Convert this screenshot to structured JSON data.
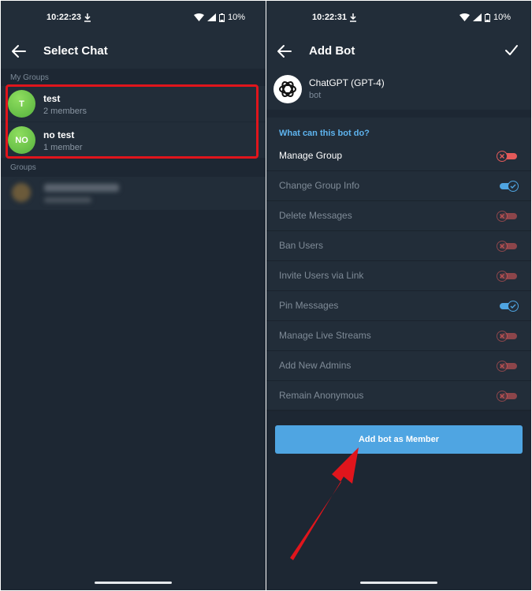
{
  "left": {
    "status_time": "10:22:23",
    "battery": "10%",
    "title": "Select Chat",
    "my_groups_label": "My Groups",
    "groups_label": "Groups",
    "chats": [
      {
        "initials": "T",
        "name": "test",
        "members": "2 members"
      },
      {
        "initials": "NO",
        "name": "no test",
        "members": "1 member"
      }
    ]
  },
  "right": {
    "status_time": "10:22:31",
    "battery": "10%",
    "title": "Add Bot",
    "bot_name": "ChatGPT (GPT-4)",
    "bot_sub": "bot",
    "heading": "What can this bot do?",
    "permissions": [
      {
        "label": "Manage Group",
        "enabled": false,
        "active": true
      },
      {
        "label": "Change Group Info",
        "enabled": true,
        "active": false
      },
      {
        "label": "Delete Messages",
        "enabled": false,
        "active": false
      },
      {
        "label": "Ban Users",
        "enabled": false,
        "active": false
      },
      {
        "label": "Invite Users via Link",
        "enabled": false,
        "active": false
      },
      {
        "label": "Pin Messages",
        "enabled": true,
        "active": false
      },
      {
        "label": "Manage Live Streams",
        "enabled": false,
        "active": false
      },
      {
        "label": "Add New Admins",
        "enabled": false,
        "active": false
      },
      {
        "label": "Remain Anonymous",
        "enabled": false,
        "active": false
      }
    ],
    "add_button": "Add bot as Member"
  },
  "colors": {
    "accent": "#4fa5e2",
    "highlight": "#e0151c",
    "toggle_on": "#4fa5e2",
    "toggle_off": "#e35a5a"
  }
}
